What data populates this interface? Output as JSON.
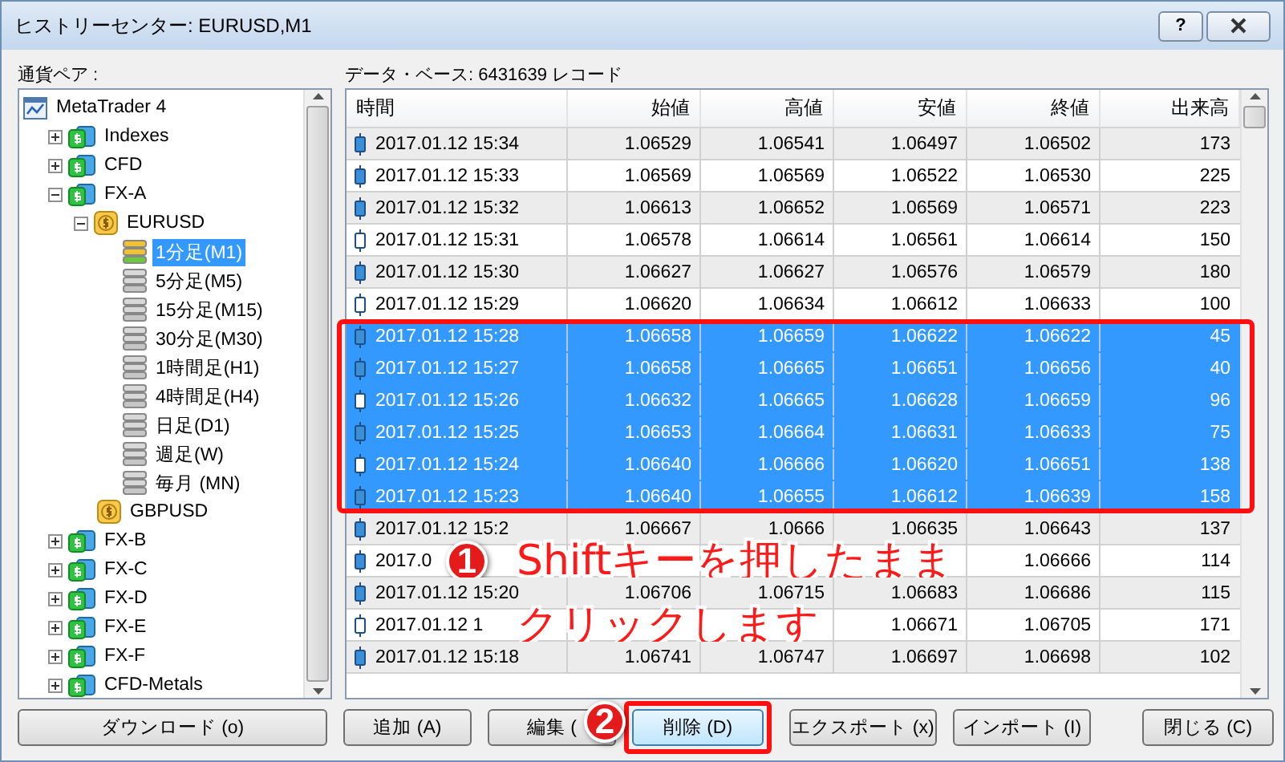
{
  "window": {
    "title": "ヒストリーセンター: EURUSD,M1",
    "help_button": "?"
  },
  "tree": {
    "label": "通貨ペア :",
    "items": [
      {
        "label": "MetaTrader 4",
        "kind": "root",
        "selected": false,
        "children": [
          {
            "label": "Indexes",
            "kind": "group",
            "expanded": false,
            "selected": false
          },
          {
            "label": "CFD",
            "kind": "group",
            "expanded": false,
            "selected": false
          },
          {
            "label": "FX-A",
            "kind": "group",
            "expanded": true,
            "selected": false,
            "children": [
              {
                "label": "EURUSD",
                "kind": "symbol",
                "expanded": true,
                "selected": false,
                "children": [
                  {
                    "label": "1分足(M1)",
                    "kind": "period",
                    "filled": true,
                    "selected": true
                  },
                  {
                    "label": "5分足(M5)",
                    "kind": "period",
                    "filled": false,
                    "selected": false
                  },
                  {
                    "label": "15分足(M15)",
                    "kind": "period",
                    "filled": false,
                    "selected": false
                  },
                  {
                    "label": "30分足(M30)",
                    "kind": "period",
                    "filled": false,
                    "selected": false
                  },
                  {
                    "label": "1時間足(H1)",
                    "kind": "period",
                    "filled": false,
                    "selected": false
                  },
                  {
                    "label": "4時間足(H4)",
                    "kind": "period",
                    "filled": false,
                    "selected": false
                  },
                  {
                    "label": "日足(D1)",
                    "kind": "period",
                    "filled": false,
                    "selected": false
                  },
                  {
                    "label": "週足(W)",
                    "kind": "period",
                    "filled": false,
                    "selected": false
                  },
                  {
                    "label": "毎月 (MN)",
                    "kind": "period",
                    "filled": false,
                    "selected": false
                  }
                ]
              },
              {
                "label": "GBPUSD",
                "kind": "symbol",
                "selected": false
              }
            ]
          },
          {
            "label": "FX-B",
            "kind": "group",
            "expanded": false,
            "selected": false
          },
          {
            "label": "FX-C",
            "kind": "group",
            "expanded": false,
            "selected": false
          },
          {
            "label": "FX-D",
            "kind": "group",
            "expanded": false,
            "selected": false
          },
          {
            "label": "FX-E",
            "kind": "group",
            "expanded": false,
            "selected": false
          },
          {
            "label": "FX-F",
            "kind": "group",
            "expanded": false,
            "selected": false
          },
          {
            "label": "CFD-Metals",
            "kind": "group",
            "expanded": false,
            "selected": false
          }
        ]
      }
    ]
  },
  "table": {
    "caption": "データ・ベース: 6431639 レコード",
    "columns": [
      "時間",
      "始値",
      "高値",
      "安値",
      "終値",
      "出来高"
    ],
    "rows": [
      {
        "kind": "filled",
        "selected": false,
        "cells": [
          "2017.01.12 15:34",
          "1.06529",
          "1.06541",
          "1.06497",
          "1.06502",
          "173"
        ]
      },
      {
        "kind": "filled",
        "selected": false,
        "cells": [
          "2017.01.12 15:33",
          "1.06569",
          "1.06569",
          "1.06522",
          "1.06530",
          "225"
        ]
      },
      {
        "kind": "filled",
        "selected": false,
        "cells": [
          "2017.01.12 15:32",
          "1.06613",
          "1.06652",
          "1.06569",
          "1.06571",
          "223"
        ]
      },
      {
        "kind": "hollow",
        "selected": false,
        "cells": [
          "2017.01.12 15:31",
          "1.06578",
          "1.06614",
          "1.06561",
          "1.06614",
          "150"
        ]
      },
      {
        "kind": "filled",
        "selected": false,
        "cells": [
          "2017.01.12 15:30",
          "1.06627",
          "1.06627",
          "1.06576",
          "1.06579",
          "180"
        ]
      },
      {
        "kind": "hollow",
        "selected": false,
        "cells": [
          "2017.01.12 15:29",
          "1.06620",
          "1.06634",
          "1.06612",
          "1.06633",
          "100"
        ]
      },
      {
        "kind": "filled",
        "selected": true,
        "cells": [
          "2017.01.12 15:28",
          "1.06658",
          "1.06659",
          "1.06622",
          "1.06622",
          "45"
        ]
      },
      {
        "kind": "filled",
        "selected": true,
        "cells": [
          "2017.01.12 15:27",
          "1.06658",
          "1.06665",
          "1.06651",
          "1.06656",
          "40"
        ]
      },
      {
        "kind": "hollow",
        "selected": true,
        "cells": [
          "2017.01.12 15:26",
          "1.06632",
          "1.06665",
          "1.06628",
          "1.06659",
          "96"
        ]
      },
      {
        "kind": "filled",
        "selected": true,
        "cells": [
          "2017.01.12 15:25",
          "1.06653",
          "1.06664",
          "1.06631",
          "1.06633",
          "75"
        ]
      },
      {
        "kind": "hollow",
        "selected": true,
        "cells": [
          "2017.01.12 15:24",
          "1.06640",
          "1.06666",
          "1.06620",
          "1.06651",
          "138"
        ]
      },
      {
        "kind": "filled",
        "selected": true,
        "cells": [
          "2017.01.12 15:23",
          "1.06640",
          "1.06655",
          "1.06612",
          "1.06639",
          "158"
        ]
      },
      {
        "kind": "filled",
        "selected": false,
        "cells": [
          "2017.01.12 15:2",
          "1.06667",
          "1.0666",
          "1.06635",
          "1.06643",
          "137"
        ]
      },
      {
        "kind": "filled",
        "selected": false,
        "cells": [
          "2017.0",
          null,
          null,
          null,
          "1.06666",
          "114"
        ]
      },
      {
        "kind": "filled",
        "selected": false,
        "cells": [
          "2017.01.12 15:20",
          "1.06706",
          "1.06715",
          "1.06683",
          "1.06686",
          "115"
        ]
      },
      {
        "kind": "hollow",
        "selected": false,
        "cells": [
          "2017.01.12 1",
          null,
          null,
          "1.06671",
          "1.06705",
          "171"
        ]
      },
      {
        "kind": "filled",
        "selected": false,
        "cells": [
          "2017.01.12 15:18",
          "1.06741",
          "1.06747",
          "1.06697",
          "1.06698",
          "102"
        ]
      }
    ]
  },
  "buttons": [
    {
      "label": "ダウンロード (o)",
      "default": false
    },
    {
      "label": "追加 (A)",
      "default": false
    },
    {
      "label": "編集 (",
      "default": false
    },
    {
      "label": "削除 (D)",
      "default": true
    },
    {
      "label": "エクスポート (x)",
      "default": false
    },
    {
      "label": "インポート (I)",
      "default": false
    },
    {
      "label": "閉じる (C)",
      "default": false
    }
  ],
  "annotations": [
    {
      "number": "1",
      "lines": [
        "Shiftキーを押したまま",
        "クリックします"
      ]
    },
    {
      "number": "2"
    }
  ]
}
